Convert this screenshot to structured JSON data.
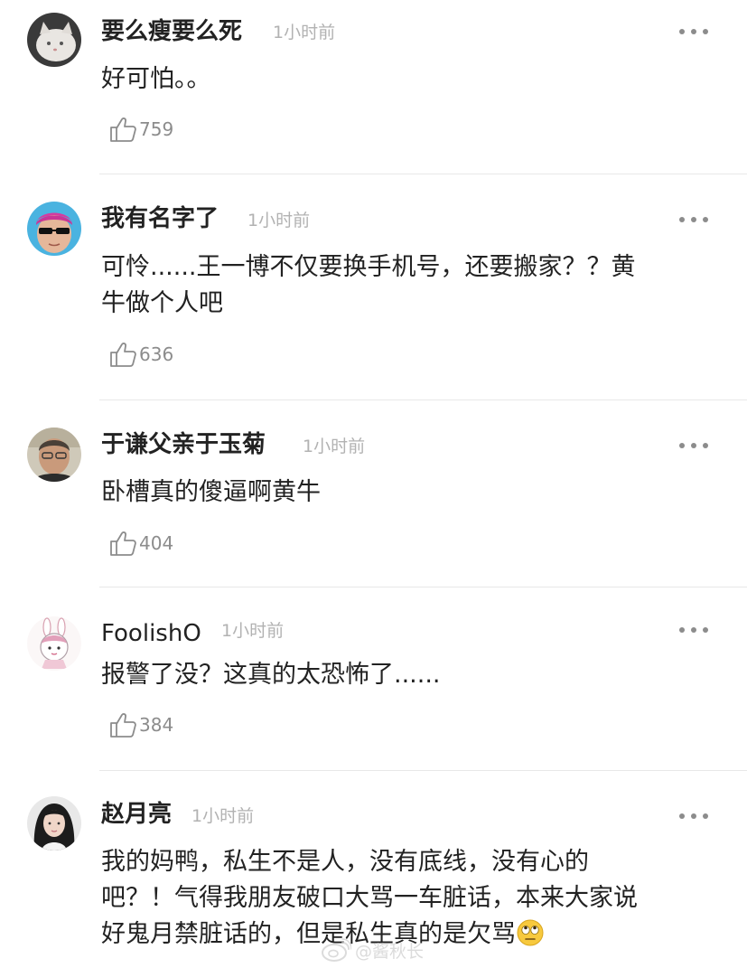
{
  "comments": [
    {
      "username": "要么瘦要么死",
      "time": "1小时前",
      "content": "好可怕。。",
      "likes": "759",
      "avatar_icon": "cat-avatar-icon"
    },
    {
      "username": "我有名字了",
      "time": "1小时前",
      "content_line1": "可怜......王一博不仅要换手机号，还要搬家？？黄",
      "content_line2": "牛做个人吧",
      "likes": "636",
      "avatar_icon": "sunglasses-person-avatar-icon"
    },
    {
      "username": "于谦父亲于玉菊",
      "time": "1小时前",
      "content": "卧槽真的傻逼啊黄牛",
      "likes": "404",
      "avatar_icon": "man-portrait-avatar-icon"
    },
    {
      "username": "FoolishO",
      "time": "1小时前",
      "content": "报警了没？这真的太恐怖了......",
      "likes": "384",
      "avatar_icon": "bunny-girl-avatar-icon"
    },
    {
      "username": "赵月亮",
      "time": "1小时前",
      "content_line1": "我的妈鸭，私生不是人，没有底线，没有心的",
      "content_line2": "吧？！气得我朋友破口大骂一车脏话，本来大家说",
      "content_line3": "好鬼月禁脏话的，但是私生真的是欠骂",
      "avatar_icon": "girl-portrait-avatar-icon"
    }
  ],
  "watermark": {
    "text": "@酱秋长",
    "icon": "weibo-logo-icon"
  },
  "colors": {
    "text": "#222222",
    "muted": "#b2b2b2",
    "icon": "#8c8c8c",
    "divider": "#e8e8e8"
  }
}
